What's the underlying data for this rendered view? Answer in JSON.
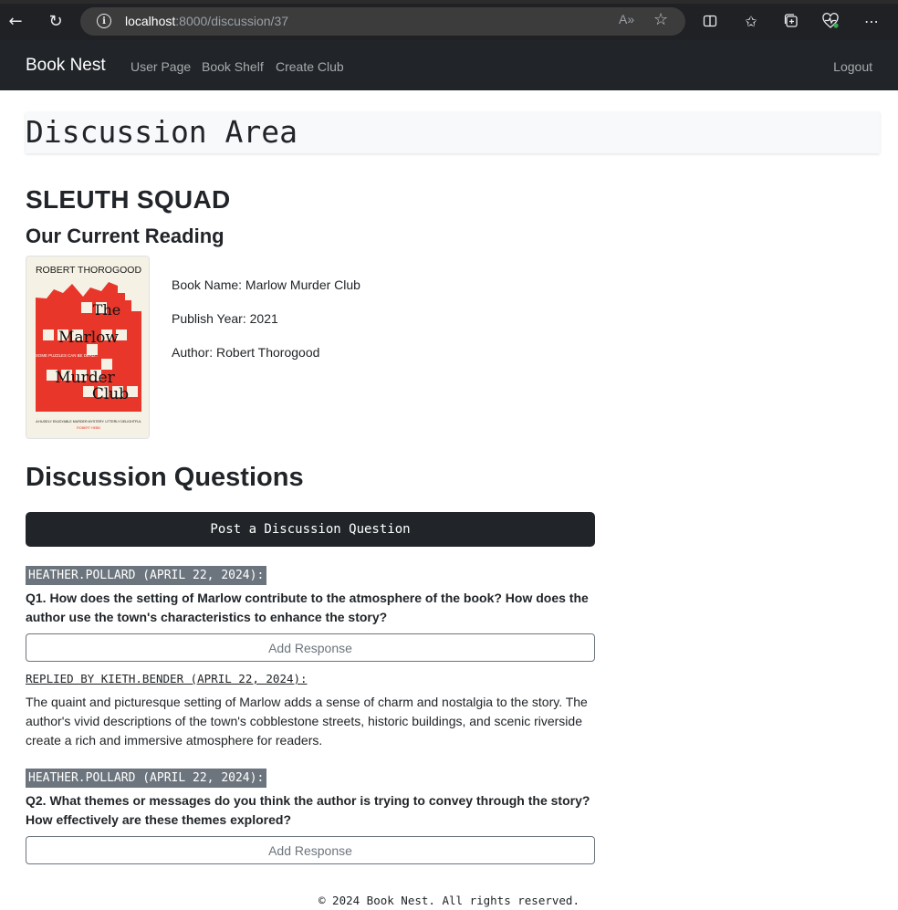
{
  "browser": {
    "url_host": "localhost",
    "url_path": ":8000/discussion/37",
    "read_aloud_label": "A»"
  },
  "navbar": {
    "brand": "Book Nest",
    "links": [
      "User Page",
      "Book Shelf",
      "Create Club"
    ],
    "logout": "Logout"
  },
  "page": {
    "title": "Discussion Area",
    "club_name": "SLEUTH SQUAD",
    "current_reading_heading": "Our Current Reading"
  },
  "book": {
    "cover_author": "ROBERT THOROGOOD",
    "cover_title_lines": [
      "The",
      "Marlow",
      "Murder",
      "Club"
    ],
    "cover_tagline": "SOME PUZZLES CAN BE DEAD...",
    "cover_blurb": "A HUGELY ENJOYABLE MURDER MYSTERY. UTTERLY DELIGHTFUL",
    "cover_blurb_source": "ROBERT HEBB",
    "name_line": "Book Name: Marlow Murder Club",
    "year_line": "Publish Year: 2021",
    "author_line": "Author: Robert Thorogood"
  },
  "discussion": {
    "heading": "Discussion Questions",
    "post_button": "Post a Discussion Question",
    "add_response_label": "Add Response",
    "questions": [
      {
        "author": "HEATHER.POLLARD (APRIL 22, 2024):",
        "text": "Q1. How does the setting of Marlow contribute to the atmosphere of the book? How does the author use the town's characteristics to enhance the story?",
        "replies": [
          {
            "by": "REPLIED BY KIETH.BENDER (APRIL 22, 2024):",
            "text": "The quaint and picturesque setting of Marlow adds a sense of charm and nostalgia to the story. The author's vivid descriptions of the town's cobblestone streets, historic buildings, and scenic riverside create a rich and immersive atmosphere for readers."
          }
        ]
      },
      {
        "author": "HEATHER.POLLARD (APRIL 22, 2024):",
        "text": "Q2. What themes or messages do you think the author is trying to convey through the story? How effectively are these themes explored?",
        "replies": []
      }
    ]
  },
  "footer": "© 2024 Book Nest. All rights reserved.",
  "colors": {
    "navbar_bg": "#212529",
    "badge_bg": "#6c757d",
    "cover_red": "#e8372a",
    "cover_cream": "#f5f1e4"
  }
}
